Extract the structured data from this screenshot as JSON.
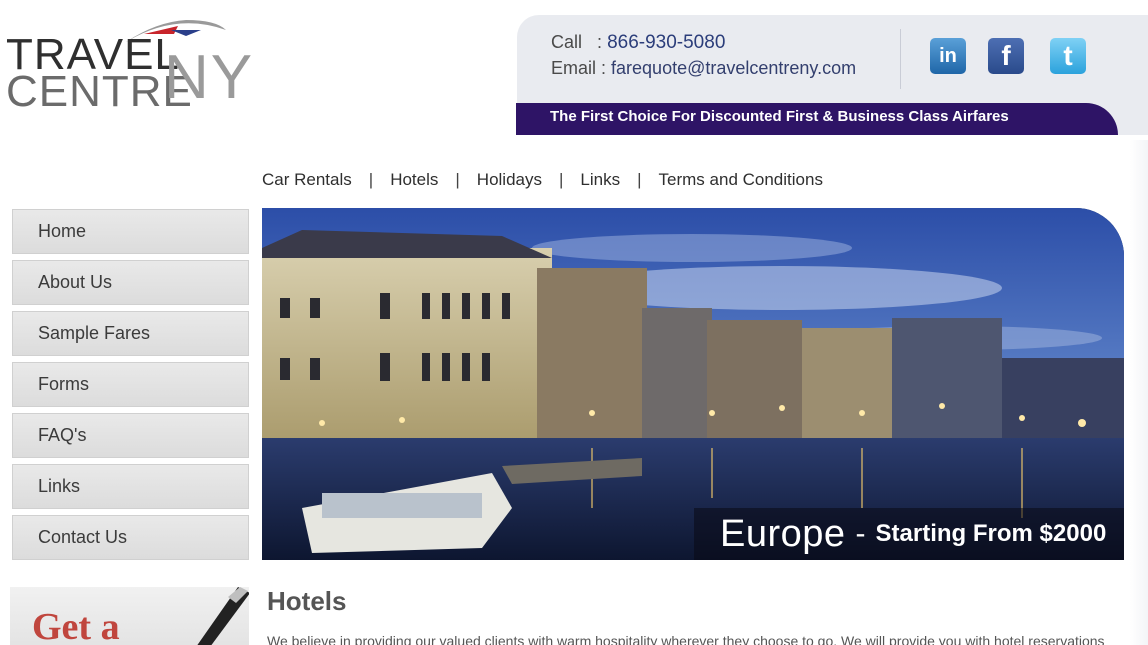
{
  "logo": {
    "line1": "TRAVEL",
    "line2": "CENTRE",
    "suffix": "NY"
  },
  "contact": {
    "call_label": "Call",
    "call_sep": ":",
    "phone": "866-930-5080",
    "email_label": "Email :",
    "email": "farequote@travelcentreny.com"
  },
  "social": [
    {
      "name": "linkedin-icon",
      "glyph": "in"
    },
    {
      "name": "facebook-icon",
      "glyph": "f"
    },
    {
      "name": "twitter-icon",
      "glyph": "t"
    }
  ],
  "tagline": "The First Choice For Discounted First & Business Class Airfares",
  "top_nav": {
    "items": [
      "Car Rentals",
      "Hotels",
      "Holidays",
      "Links",
      "Terms and Conditions"
    ],
    "separator": "|"
  },
  "sidebar": {
    "items": [
      "Home",
      "About Us",
      "Sample Fares",
      "Forms",
      "FAQ's",
      "Links",
      "Contact Us"
    ]
  },
  "hero": {
    "destination": "Europe",
    "dash": "-",
    "price_text": "Starting From $2000"
  },
  "quote_banner": {
    "text": "Get a"
  },
  "content": {
    "title": "Hotels",
    "body": "We believe in providing our valued clients with warm hospitality wherever they choose to go. We will provide you with hotel reservations"
  },
  "colors": {
    "tagline_bg": "#2e1466",
    "panel_bg": "#e9ebf0",
    "sidebar_bg": "#e3e3e3",
    "phone_color": "#2b3d7a",
    "quote_red": "#c0463e"
  }
}
